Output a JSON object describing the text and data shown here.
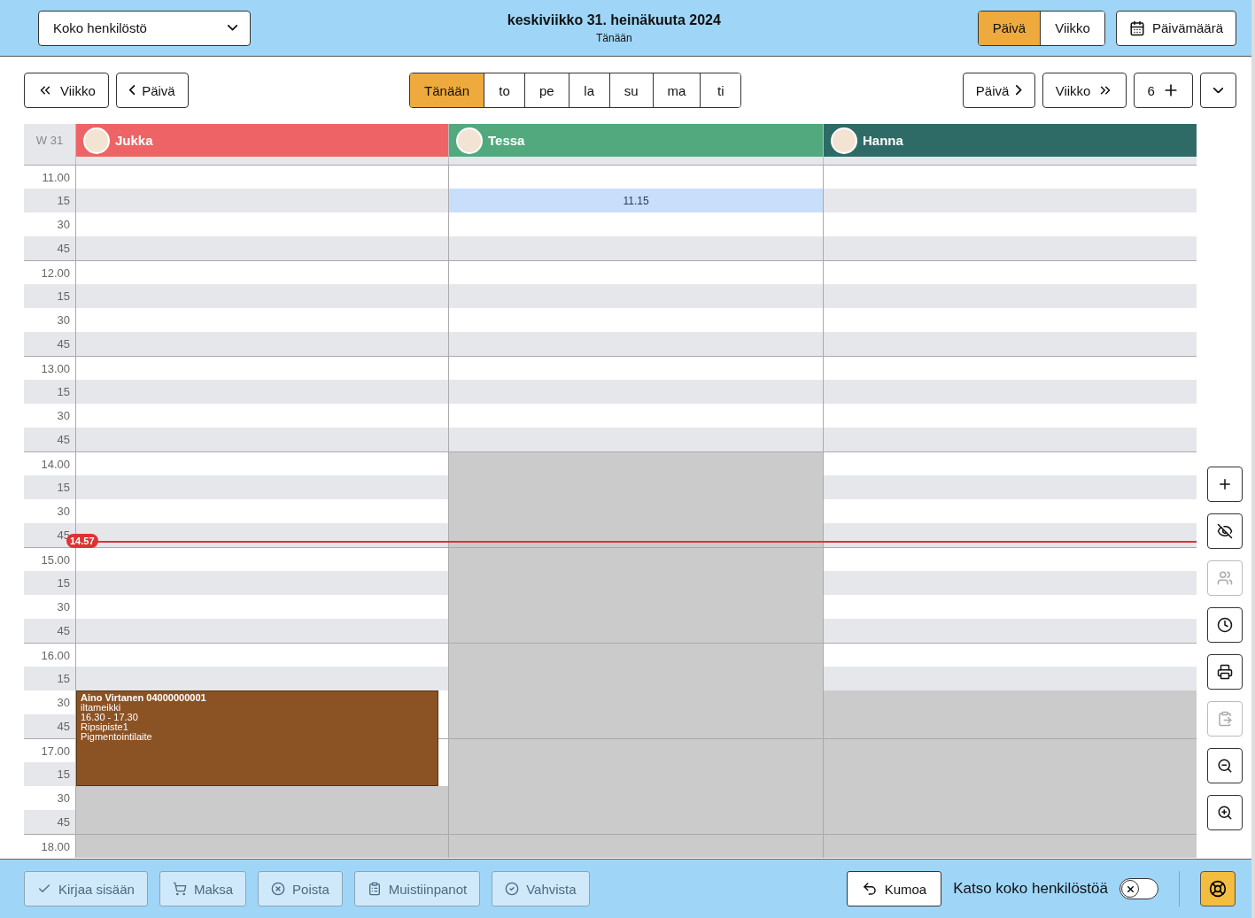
{
  "header": {
    "staff_filter": {
      "value": "Koko henkilöstö"
    },
    "title": "keskiviikko 31. heinäkuuta 2024",
    "subtitle": "Tänään",
    "view_toggle": [
      {
        "label": "Päivä",
        "selected": true
      },
      {
        "label": "Viikko",
        "selected": false
      }
    ],
    "date_button": "Päivämäärä"
  },
  "toolbar": {
    "back_buttons": [
      "Viikko",
      "Päivä"
    ],
    "day_tabs": [
      {
        "label": "Tänään",
        "selected": true
      },
      {
        "label": "to",
        "selected": false
      },
      {
        "label": "pe",
        "selected": false
      },
      {
        "label": "la",
        "selected": false
      },
      {
        "label": "su",
        "selected": false
      },
      {
        "label": "ma",
        "selected": false
      },
      {
        "label": "ti",
        "selected": false
      }
    ],
    "forward_buttons": [
      "Päivä",
      "Viikko"
    ],
    "count_button": "6"
  },
  "calendar": {
    "week_label": "W 31",
    "staff": [
      {
        "name": "Jukka",
        "color": "#ee6466",
        "slots": [
          {
            "kind": "open"
          },
          {
            "kind": "open"
          },
          {
            "kind": "open"
          },
          {
            "kind": "open"
          },
          {
            "kind": "open"
          },
          {
            "kind": "open"
          },
          {
            "kind": "open"
          },
          {
            "kind": "open"
          },
          {
            "kind": "open"
          },
          {
            "kind": "open"
          },
          {
            "kind": "open"
          },
          {
            "kind": "open"
          },
          {
            "kind": "open"
          },
          {
            "kind": "open"
          },
          {
            "kind": "open"
          },
          {
            "kind": "open"
          },
          {
            "kind": "open"
          },
          {
            "kind": "open"
          },
          {
            "kind": "open"
          },
          {
            "kind": "open"
          },
          {
            "kind": "open"
          },
          {
            "kind": "open"
          },
          {
            "kind": "booked"
          },
          {
            "kind": "booked"
          },
          {
            "kind": "booked"
          },
          {
            "kind": "booked"
          },
          {
            "kind": "closed"
          },
          {
            "kind": "closed"
          },
          {
            "kind": "closed"
          }
        ],
        "event": {
          "title": "Aino Virtanen 04000000001",
          "lines": [
            "iltameikki",
            "16.30 - 17.30",
            "Ripsipiste1",
            "Pigmentointilaite"
          ]
        }
      },
      {
        "name": "Tessa",
        "color": "#52a97e",
        "slots": [
          {
            "kind": "open"
          },
          {
            "kind": "selected"
          },
          {
            "kind": "open"
          },
          {
            "kind": "open"
          },
          {
            "kind": "open"
          },
          {
            "kind": "open"
          },
          {
            "kind": "open"
          },
          {
            "kind": "open"
          },
          {
            "kind": "open"
          },
          {
            "kind": "open"
          },
          {
            "kind": "open"
          },
          {
            "kind": "open"
          },
          {
            "kind": "closed"
          },
          {
            "kind": "closed"
          },
          {
            "kind": "closed"
          },
          {
            "kind": "closed"
          },
          {
            "kind": "closed"
          },
          {
            "kind": "closed"
          },
          {
            "kind": "closed"
          },
          {
            "kind": "closed"
          },
          {
            "kind": "closed"
          },
          {
            "kind": "closed"
          },
          {
            "kind": "closed"
          },
          {
            "kind": "closed"
          },
          {
            "kind": "closed"
          },
          {
            "kind": "closed"
          },
          {
            "kind": "closed"
          },
          {
            "kind": "closed"
          },
          {
            "kind": "closed"
          }
        ],
        "selection": "11.15"
      },
      {
        "name": "Hanna",
        "color": "#2e6b66",
        "slots": [
          {
            "kind": "open"
          },
          {
            "kind": "open"
          },
          {
            "kind": "open"
          },
          {
            "kind": "open"
          },
          {
            "kind": "open"
          },
          {
            "kind": "open"
          },
          {
            "kind": "open"
          },
          {
            "kind": "open"
          },
          {
            "kind": "open"
          },
          {
            "kind": "open"
          },
          {
            "kind": "open"
          },
          {
            "kind": "open"
          },
          {
            "kind": "open"
          },
          {
            "kind": "open"
          },
          {
            "kind": "open"
          },
          {
            "kind": "open"
          },
          {
            "kind": "open"
          },
          {
            "kind": "open"
          },
          {
            "kind": "open"
          },
          {
            "kind": "open"
          },
          {
            "kind": "open"
          },
          {
            "kind": "open"
          },
          {
            "kind": "closed"
          },
          {
            "kind": "closed"
          },
          {
            "kind": "closed"
          },
          {
            "kind": "closed"
          },
          {
            "kind": "closed"
          },
          {
            "kind": "closed"
          },
          {
            "kind": "closed"
          }
        ]
      }
    ],
    "times": [
      {
        "label": "11.00",
        "kind": "hour"
      },
      {
        "label": "15",
        "kind": "quarter"
      },
      {
        "label": "30",
        "kind": "quarter"
      },
      {
        "label": "45",
        "kind": "quarter"
      },
      {
        "label": "12.00",
        "kind": "hour"
      },
      {
        "label": "15",
        "kind": "quarter"
      },
      {
        "label": "30",
        "kind": "quarter"
      },
      {
        "label": "45",
        "kind": "quarter"
      },
      {
        "label": "13.00",
        "kind": "hour"
      },
      {
        "label": "15",
        "kind": "quarter"
      },
      {
        "label": "30",
        "kind": "quarter"
      },
      {
        "label": "45",
        "kind": "quarter"
      },
      {
        "label": "14.00",
        "kind": "hour"
      },
      {
        "label": "15",
        "kind": "quarter"
      },
      {
        "label": "30",
        "kind": "quarter"
      },
      {
        "label": "45",
        "kind": "quarter",
        "now_marker": "14.57"
      },
      {
        "label": "15.00",
        "kind": "hour"
      },
      {
        "label": "15",
        "kind": "quarter"
      },
      {
        "label": "30",
        "kind": "quarter"
      },
      {
        "label": "45",
        "kind": "quarter"
      },
      {
        "label": "16.00",
        "kind": "hour"
      },
      {
        "label": "15",
        "kind": "quarter"
      },
      {
        "label": "30",
        "kind": "quarter"
      },
      {
        "label": "45",
        "kind": "quarter"
      },
      {
        "label": "17.00",
        "kind": "hour"
      },
      {
        "label": "15",
        "kind": "quarter"
      },
      {
        "label": "30",
        "kind": "quarter"
      },
      {
        "label": "45",
        "kind": "quarter"
      },
      {
        "label": "18.00",
        "kind": "hour"
      }
    ]
  },
  "side_tools": [
    {
      "disabled": false
    },
    {
      "disabled": false
    },
    {
      "disabled": true
    },
    {
      "disabled": false
    },
    {
      "disabled": false
    },
    {
      "disabled": true
    },
    {
      "disabled": false
    },
    {
      "disabled": false
    }
  ],
  "footer": {
    "actions": [
      {
        "label": "Kirjaa sisään",
        "disabled": true
      },
      {
        "label": "Maksa",
        "disabled": true
      },
      {
        "label": "Poista",
        "disabled": true
      },
      {
        "label": "Muistiinpanot",
        "disabled": true
      },
      {
        "label": "Vahvista",
        "disabled": true
      }
    ],
    "undo": "Kumoa",
    "all_staff_toggle": {
      "label": "Katso koko henkilöstöä",
      "on": false
    }
  }
}
